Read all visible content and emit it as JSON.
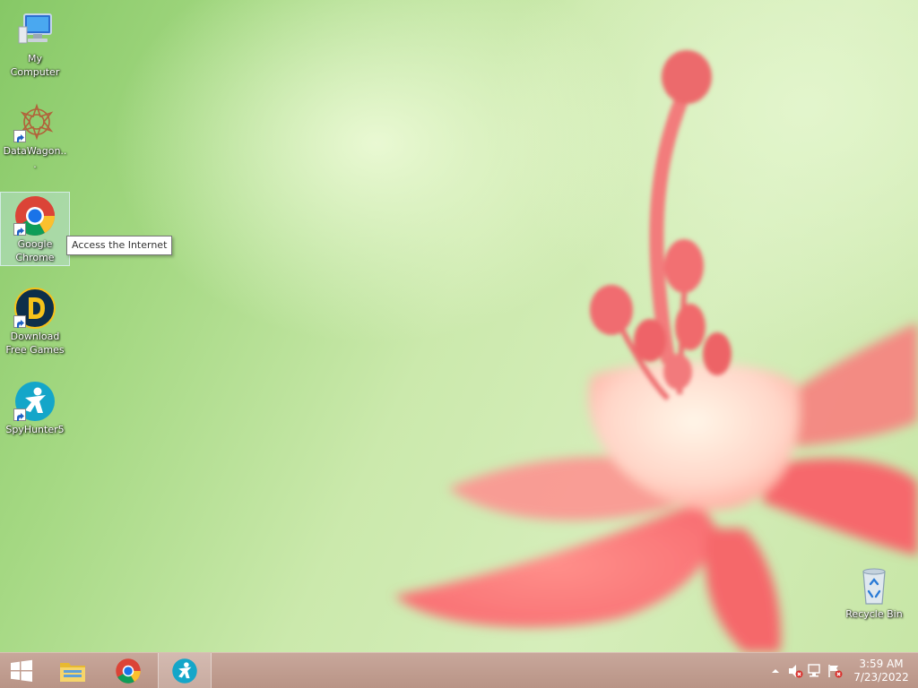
{
  "desktop_icons": [
    {
      "label": "My Computer"
    },
    {
      "label": "DataWagon..."
    },
    {
      "label": "Google Chrome"
    },
    {
      "label": "Download Free Games"
    },
    {
      "label": "SpyHunter5"
    }
  ],
  "recycle_bin": {
    "label": "Recycle Bin"
  },
  "tooltip": {
    "text": "Access the Internet"
  },
  "taskbar": {
    "clock": {
      "time": "3:59 AM",
      "date": "7/23/2022"
    }
  },
  "colors": {
    "taskbar": "#c0a093",
    "flower": "#f2777a",
    "wallpaper": "#b9e09a"
  }
}
